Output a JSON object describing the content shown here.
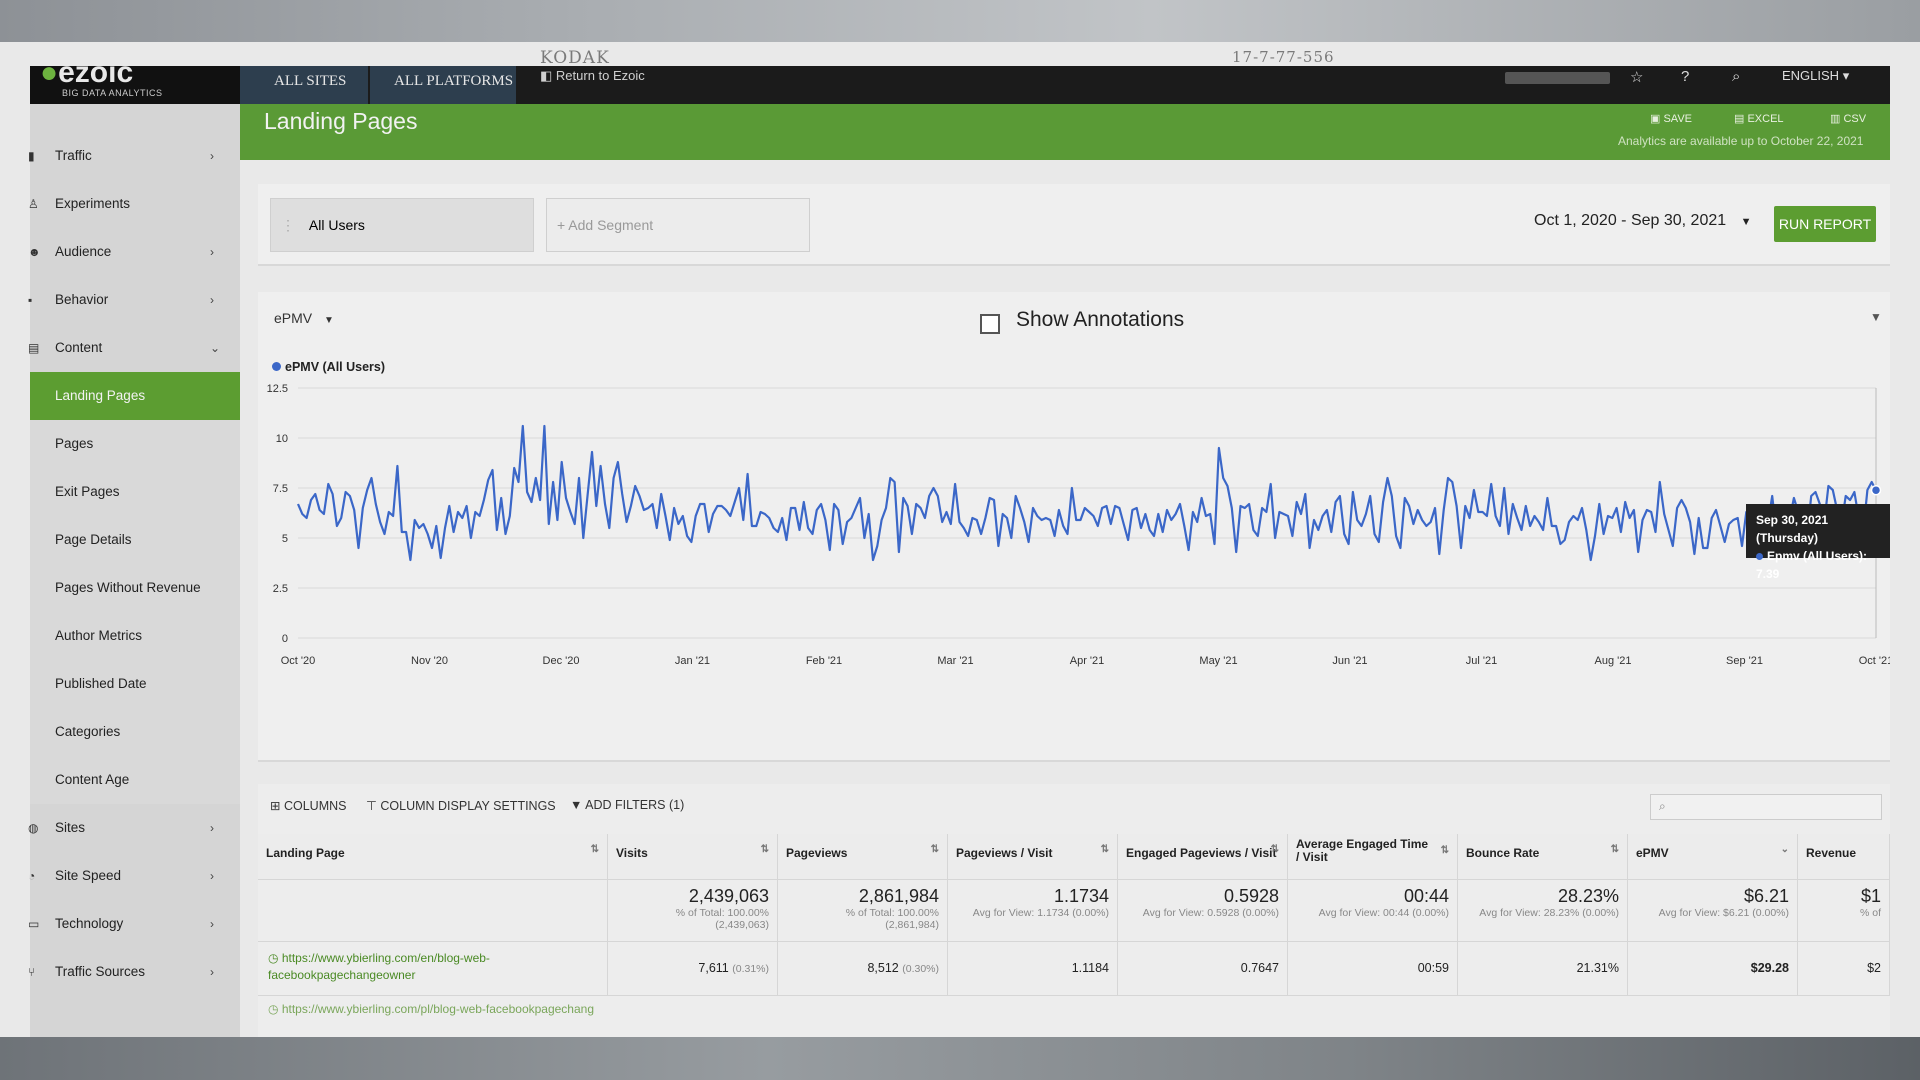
{
  "overlay": {
    "brand": "KODAK",
    "code": "17-7-77-556"
  },
  "app": {
    "logo": "ezoic",
    "logo_sub": "BIG DATA ANALYTICS"
  },
  "topnav": {
    "tabs": [
      "ALL SITES",
      "ALL PLATFORMS"
    ],
    "return_label": "Return to Ezoic",
    "language": "ENGLISH"
  },
  "sidebar": {
    "items": [
      {
        "label": "Traffic"
      },
      {
        "label": "Experiments"
      },
      {
        "label": "Audience"
      },
      {
        "label": "Behavior"
      },
      {
        "label": "Content"
      }
    ],
    "content_subitems": [
      {
        "label": "Landing Pages"
      },
      {
        "label": "Pages"
      },
      {
        "label": "Exit Pages"
      },
      {
        "label": "Page Details"
      },
      {
        "label": "Pages Without Revenue"
      },
      {
        "label": "Author Metrics"
      },
      {
        "label": "Published Date"
      },
      {
        "label": "Categories"
      },
      {
        "label": "Content Age"
      }
    ],
    "bottom_items": [
      {
        "label": "Sites"
      },
      {
        "label": "Site Speed"
      },
      {
        "label": "Technology"
      },
      {
        "label": "Traffic Sources"
      }
    ]
  },
  "header": {
    "title": "Landing Pages",
    "save": "SAVE",
    "excel": "EXCEL",
    "csv": "CSV",
    "availability": "Analytics are available up to October 22, 2021"
  },
  "segments": {
    "active": "All Users",
    "add_placeholder": "+ Add Segment",
    "date_range": "Oct 1, 2020 - Sep 30, 2021",
    "run_report": "RUN REPORT"
  },
  "chart_controls": {
    "metric": "ePMV",
    "show_annotations": "Show Annotations",
    "annotations_checked": false
  },
  "tooltip": {
    "date": "Sep 30, 2021 (Thursday)",
    "series_value": "Epmv (All Users): 7.39"
  },
  "chart_data": {
    "type": "line",
    "title": "",
    "xlabel": "",
    "ylabel": "",
    "ylim": [
      0,
      12.5
    ],
    "yticks": [
      "0",
      "2.5",
      "5",
      "7.5",
      "10",
      "12.5"
    ],
    "xticks": [
      "Oct '20",
      "Nov '20",
      "Dec '20",
      "Jan '21",
      "Feb '21",
      "Mar '21",
      "Apr '21",
      "May '21",
      "Jun '21",
      "Jul '21",
      "Aug '21",
      "Sep '21",
      "Oct '21"
    ],
    "grid": true,
    "legend": "top-left",
    "color": "#3b67c8",
    "x_start": "2020-10-01",
    "x_end": "2021-09-30",
    "series": [
      {
        "name": "ePMV (All Users)",
        "values": [
          6.7,
          6.2,
          6.0,
          6.9,
          7.2,
          6.4,
          6.2,
          7.7,
          7.2,
          5.6,
          6.0,
          7.3,
          7.1,
          6.4,
          4.5,
          6.5,
          7.4,
          8.0,
          6.7,
          5.8,
          5.2,
          6.3,
          6.1,
          8.6,
          5.3,
          5.3,
          3.9,
          5.9,
          5.5,
          5.7,
          5.2,
          4.5,
          5.6,
          4.0,
          5.5,
          6.6,
          5.3,
          6.3,
          6.0,
          6.6,
          5.0,
          6.3,
          6.1,
          6.9,
          7.9,
          8.4,
          5.4,
          7.0,
          5.2,
          6.1,
          8.5,
          7.8,
          10.6,
          7.3,
          6.8,
          8.0,
          6.9,
          10.6,
          5.7,
          7.8,
          5.9,
          8.8,
          7.0,
          6.3,
          5.7,
          8.0,
          5.0,
          7.2,
          9.3,
          6.6,
          8.6,
          6.7,
          5.5,
          8.0,
          8.8,
          7.2,
          5.8,
          6.6,
          7.6,
          7.1,
          6.4,
          6.5,
          6.7,
          5.5,
          7.2,
          6.1,
          4.9,
          6.5,
          5.7,
          6.1,
          5.1,
          4.8,
          6.1,
          6.7,
          6.7,
          5.3,
          6.2,
          6.6,
          6.6,
          6.4,
          6.1,
          6.8,
          7.5,
          5.9,
          8.2,
          5.6,
          5.6,
          6.3,
          6.2,
          6.0,
          5.5,
          5.3,
          6.0,
          4.9,
          6.5,
          6.5,
          5.4,
          6.8,
          5.5,
          5.2,
          6.4,
          6.7,
          5.9,
          4.4,
          6.7,
          6.4,
          4.7,
          5.8,
          6.0,
          6.5,
          7.0,
          5.0,
          6.2,
          3.9,
          4.6,
          5.9,
          6.5,
          8.0,
          7.8,
          4.3,
          7.0,
          6.6,
          5.2,
          6.7,
          6.5,
          6.0,
          7.1,
          7.5,
          7.1,
          5.8,
          6.3,
          5.7,
          7.7,
          5.8,
          5.5,
          5.1,
          6.0,
          5.9,
          5.2,
          6.0,
          7.0,
          6.9,
          4.6,
          6.2,
          6.0,
          5.0,
          7.1,
          6.5,
          5.8,
          4.8,
          6.5,
          6.1,
          5.9,
          6.0,
          5.9,
          5.1,
          6.4,
          5.6,
          5.2,
          7.5,
          5.9,
          5.9,
          6.5,
          6.3,
          6.1,
          5.6,
          6.5,
          6.6,
          5.7,
          6.6,
          6.5,
          5.7,
          4.9,
          6.4,
          6.5,
          5.5,
          6.2,
          5.4,
          5.1,
          6.2,
          5.3,
          6.4,
          5.9,
          6.2,
          6.7,
          5.6,
          4.4,
          6.3,
          5.8,
          7.0,
          6.1,
          6.2,
          4.7,
          9.5,
          8.0,
          7.6,
          6.5,
          4.3,
          6.6,
          6.5,
          6.7,
          5.4,
          5.1,
          6.5,
          6.3,
          7.7,
          5.0,
          6.3,
          6.2,
          6.1,
          5.1,
          6.8,
          6.2,
          7.2,
          4.5,
          5.9,
          5.4,
          6.1,
          6.4,
          5.3,
          6.8,
          7.1,
          5.2,
          4.7,
          7.3,
          5.9,
          5.6,
          6.2,
          7.1,
          5.2,
          4.8,
          6.8,
          8.0,
          7.1,
          5.1,
          4.5,
          7.0,
          6.6,
          5.7,
          6.4,
          5.9,
          5.6,
          5.8,
          6.5,
          4.2,
          6.4,
          8.0,
          7.8,
          6.6,
          4.5,
          6.6,
          6.0,
          7.4,
          6.3,
          6.3,
          6.1,
          7.7,
          6.1,
          5.6,
          7.5,
          5.2,
          6.7,
          6.0,
          5.4,
          6.6,
          5.6,
          6.1,
          5.8,
          5.4,
          7.0,
          5.6,
          5.6,
          4.7,
          4.9,
          5.8,
          6.1,
          5.9,
          6.5,
          5.4,
          3.9,
          5.1,
          6.7,
          5.2,
          6.1,
          6.0,
          6.5,
          5.3,
          6.8,
          6.0,
          6.4,
          4.3,
          5.9,
          6.4,
          6.3,
          5.3,
          7.8,
          6.2,
          5.4,
          4.6,
          6.5,
          6.9,
          6.5,
          5.8,
          4.2,
          6.0,
          4.5,
          4.5,
          6.0,
          6.4,
          5.6,
          4.8,
          5.7,
          5.9,
          6.0,
          4.6,
          6.3,
          6.5,
          5.2,
          6.5,
          6.3,
          5.7,
          7.1,
          5.2,
          6.0,
          6.2,
          5.9,
          7.0,
          6.3,
          6.6,
          4.9,
          7.1,
          7.3,
          6.7,
          5.7,
          7.6,
          7.4,
          6.4,
          5.6,
          7.1,
          6.9,
          7.3,
          6.0,
          5.2,
          7.4,
          7.8,
          7.39
        ]
      }
    ]
  },
  "table": {
    "toolbar": {
      "columns": "COLUMNS",
      "display_settings": "COLUMN DISPLAY SETTINGS",
      "add_filters": "ADD FILTERS (1)"
    },
    "headers": [
      "Landing Page",
      "Visits",
      "Pageviews",
      "Pageviews / Visit",
      "Engaged Pageviews / Visit",
      "Average Engaged Time / Visit",
      "Bounce Rate",
      "ePMV",
      "Revenue"
    ],
    "totals": [
      {
        "big": "2,439,063",
        "sm1": "% of Total: 100.00%",
        "sm2": "(2,439,063)"
      },
      {
        "big": "2,861,984",
        "sm1": "% of Total: 100.00%",
        "sm2": "(2,861,984)"
      },
      {
        "big": "1.1734",
        "sm1": "Avg for View: 1.1734 (0.00%)",
        "sm2": ""
      },
      {
        "big": "0.5928",
        "sm1": "Avg for View: 0.5928 (0.00%)",
        "sm2": ""
      },
      {
        "big": "00:44",
        "sm1": "Avg for View: 00:44 (0.00%)",
        "sm2": ""
      },
      {
        "big": "28.23%",
        "sm1": "Avg for View: 28.23% (0.00%)",
        "sm2": ""
      },
      {
        "big": "$6.21",
        "sm1": "Avg for View: $6.21 (0.00%)",
        "sm2": ""
      },
      {
        "big": "$1",
        "sm1": "% of",
        "sm2": ""
      }
    ],
    "row1": {
      "url": "https://www.ybierling.com/en/blog-web-facebookpagechangeowner",
      "visits": "7,611",
      "visits_pct": "(0.31%)",
      "pageviews": "8,512",
      "pageviews_pct": "(0.30%)",
      "pv_per_visit": "1.1184",
      "engaged_pv": "0.7647",
      "engaged_time": "00:59",
      "bounce": "21.31%",
      "epmv": "$29.28",
      "revenue": "$2"
    },
    "row2_url": "https://www.ybierling.com/pl/blog-web-facebookpagechang"
  }
}
